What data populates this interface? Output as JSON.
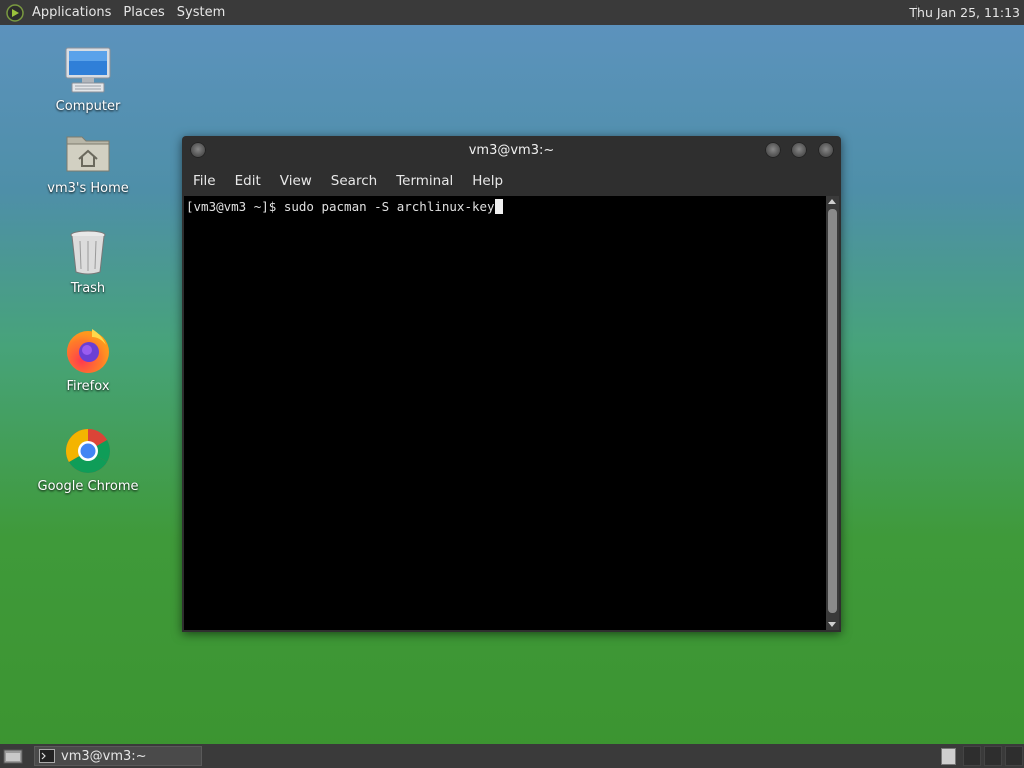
{
  "top_panel": {
    "menu": [
      "Applications",
      "Places",
      "System"
    ],
    "clock": "Thu Jan 25, 11:13"
  },
  "desktop_icons": [
    {
      "label": "Computer",
      "icon": "computer-icon"
    },
    {
      "label": "vm3's Home",
      "icon": "home-folder-icon"
    },
    {
      "label": "Trash",
      "icon": "trash-icon"
    },
    {
      "label": "Firefox",
      "icon": "firefox-icon"
    },
    {
      "label": "Google Chrome",
      "icon": "chrome-icon"
    }
  ],
  "terminal": {
    "title": "vm3@vm3:~",
    "menu": [
      "File",
      "Edit",
      "View",
      "Search",
      "Terminal",
      "Help"
    ],
    "prompt": "[vm3@vm3 ~]$ ",
    "command": "sudo pacman -S archlinux-key"
  },
  "taskbar": {
    "window_label": "vm3@vm3:~"
  },
  "colors": {
    "panel": "#3a3a3a",
    "terminal_bg": "#000000",
    "window_chrome": "#2f2f2f"
  }
}
